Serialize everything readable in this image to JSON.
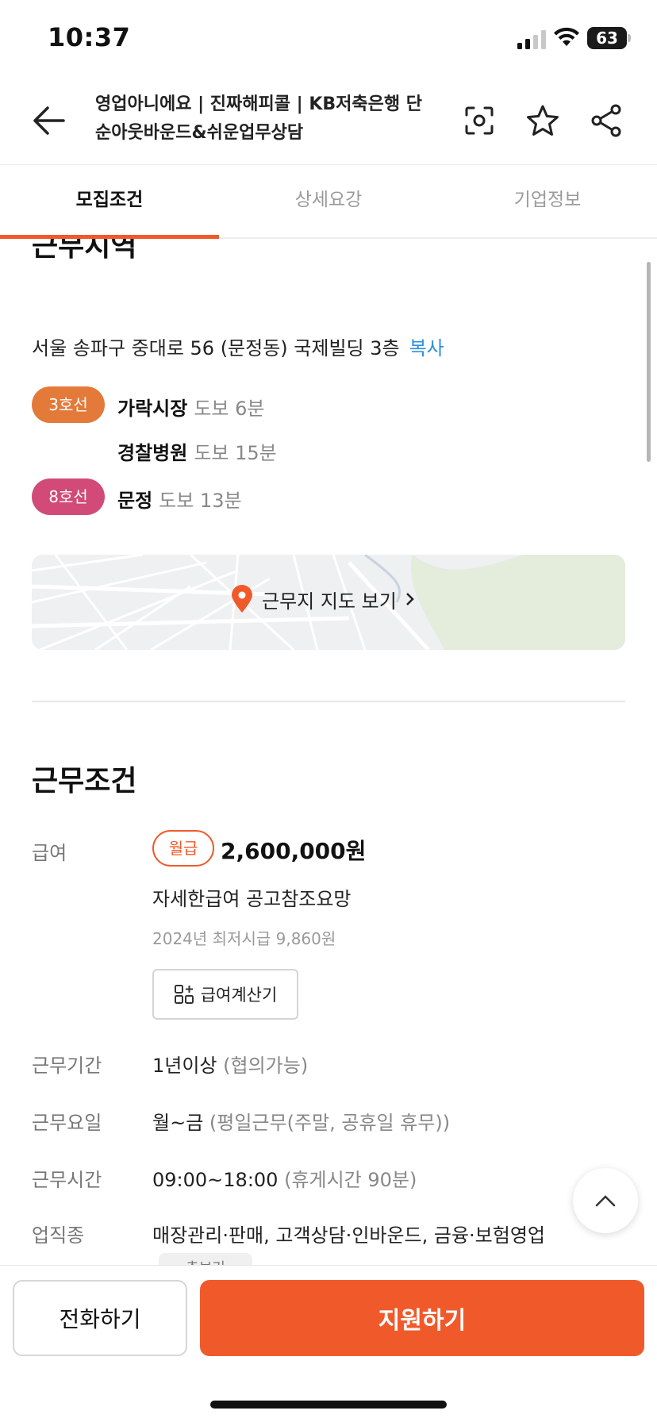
{
  "status_bar": {
    "time": "10:37",
    "battery": "63"
  },
  "header": {
    "title": "영업아니에요 | 진짜해피콜 | KB저축은행 단순아웃바운드&쉬운업무상담",
    "icons": [
      "back-arrow-icon",
      "scan-icon",
      "star-icon",
      "share-icon"
    ]
  },
  "tabs": [
    {
      "label": "모집조건",
      "active": true
    },
    {
      "label": "상세요강",
      "active": false
    },
    {
      "label": "기업정보",
      "active": false
    }
  ],
  "work_area": {
    "title": "근무지역",
    "address": "서울 송파구 중대로 56 (문정동) 국제빌딩 3층",
    "copy_label": "복사",
    "lines": [
      {
        "badge": "3호선",
        "color": "#e37a3a",
        "stations": [
          {
            "name": "가락시장",
            "walk": "도보 6분"
          },
          {
            "name": "경찰병원",
            "walk": "도보 15분"
          }
        ]
      },
      {
        "badge": "8호선",
        "color": "#d14a78",
        "stations": [
          {
            "name": "문정",
            "walk": "도보 13분"
          }
        ]
      }
    ],
    "map_label": "근무지 지도 보기"
  },
  "conditions": {
    "title": "근무조건",
    "pay_label": "급여",
    "pay_type": "월급",
    "pay_amount": "2,600,000원",
    "pay_note": "자세한급여 공고참조요망",
    "min_wage": "2024년 최저시급 9,860원",
    "calc_button": "급여계산기",
    "period_label": "근무기간",
    "period_value": "1년이상",
    "period_note": "(협의가능)",
    "days_label": "근무요일",
    "days_value": "월~금",
    "days_note": "(평일근무(주말, 공휴일 휴무))",
    "hours_label": "근무시간",
    "hours_value": "09:00~18:00",
    "hours_note": "(휴게시간 90분)",
    "job_label": "업직종",
    "job_value": "매장관리·판매, 고객상담·인바운드, 금융·보험영업",
    "more_label": "추보기"
  },
  "bottom_bar": {
    "call_label": "전화하기",
    "apply_label": "지원하기"
  },
  "colors": {
    "accent": "#f05a2b",
    "link": "#2f8fe0"
  }
}
